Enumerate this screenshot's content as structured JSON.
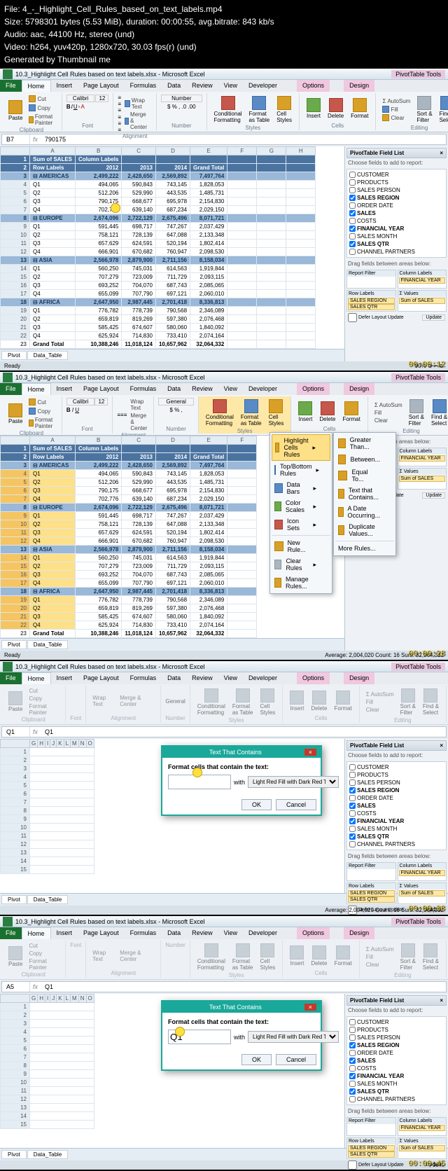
{
  "header": {
    "l1": "File: 4_-_Highlight_Cell_Rules_based_on_text_labels.mp4",
    "l2": "Size: 5798301 bytes (5.53 MiB), duration: 00:00:55, avg.bitrate: 843 kb/s",
    "l3": "Audio: aac, 44100 Hz, stereo (und)",
    "l4": "Video: h264, yuv420p, 1280x720, 30.03 fps(r) (und)",
    "l5": "Generated by Thumbnail me"
  },
  "title": "10.3_Highlight Cell Rules based on text labels.xlsx - Microsoft Excel",
  "ctxtab": "PivotTable Tools",
  "ctxsubs": {
    "opt": "Options",
    "des": "Design"
  },
  "tabs": {
    "file": "File",
    "home": "Home",
    "insert": "Insert",
    "layout": "Page Layout",
    "formulas": "Formulas",
    "data": "Data",
    "review": "Review",
    "view": "View",
    "dev": "Developer"
  },
  "rib": {
    "clipboard": "Clipboard",
    "font": "Font",
    "alignment": "Alignment",
    "number": "Number",
    "styles": "Styles",
    "cells": "Cells",
    "editing": "Editing",
    "paste": "Paste",
    "cut": "Cut",
    "copy": "Copy",
    "fpaint": "Format Painter",
    "fontname": "Calibri",
    "fontsize": "12",
    "wrap": "Wrap Text",
    "merge": "Merge & Center",
    "fmtNumber": "Number",
    "fmtGeneral": "General",
    "condf": "Conditional\nFormatting",
    "fat": "Format\nas Table",
    "cstyles": "Cell\nStyles",
    "insertc": "Insert",
    "deletec": "Delete",
    "formatc": "Format",
    "autosum": "AutoSum",
    "fill": "Fill",
    "clear": "Clear",
    "sortf": "Sort &\nFilter",
    "finds": "Find &\nSelect"
  },
  "nb1": {
    "cell": "B7",
    "val": "790175"
  },
  "nb3": {
    "cell": "Q1",
    "val": "Q1"
  },
  "nb4": {
    "cell": "A5",
    "val": "Q1"
  },
  "cols": [
    "A",
    "B",
    "C",
    "D",
    "E",
    "F",
    "G",
    "H",
    "I",
    "J",
    "K"
  ],
  "pivot": {
    "r1": {
      "a": "Sum of SALES",
      "b": "Column Labels"
    },
    "r2": {
      "a": "Row Labels",
      "b": "2012",
      "c": "2013",
      "d": "2014",
      "e": "Grand Total"
    },
    "reg1": {
      "a": "⊟ AMERICAS",
      "b": "2,499,222",
      "c": "2,428,650",
      "d": "2,569,892",
      "e": "7,497,764"
    },
    "q1a": {
      "a": "Q1",
      "b": "494,065",
      "c": "590,843",
      "d": "743,145",
      "e": "1,828,053"
    },
    "q2a": {
      "a": "Q2",
      "b": "512,206",
      "c": "529,990",
      "d": "443,535",
      "e": "1,485,731"
    },
    "q3a": {
      "a": "Q3",
      "b": "790,175",
      "c": "668,677",
      "d": "695,978",
      "e": "2,154,830"
    },
    "q4a": {
      "a": "Q4",
      "b": "702,776",
      "c": "639,140",
      "d": "687,234",
      "e": "2,029,150"
    },
    "reg2": {
      "a": "⊟ EUROPE",
      "b": "2,674,096",
      "c": "2,722,129",
      "d": "2,675,496",
      "e": "8,071,721"
    },
    "q1e": {
      "a": "Q1",
      "b": "591,445",
      "c": "698,717",
      "d": "747,267",
      "e": "2,037,429"
    },
    "q2e": {
      "a": "Q2",
      "b": "758,121",
      "c": "728,139",
      "d": "647,088",
      "e": "2,133,348"
    },
    "q3e": {
      "a": "Q3",
      "b": "657,629",
      "c": "624,591",
      "d": "520,194",
      "e": "1,802,414"
    },
    "q4e": {
      "a": "Q4",
      "b": "666,901",
      "c": "670,682",
      "d": "760,947",
      "e": "2,098,530"
    },
    "reg3": {
      "a": "⊟ ASIA",
      "b": "2,566,978",
      "c": "2,879,900",
      "d": "2,711,156",
      "e": "8,158,034"
    },
    "q1s": {
      "a": "Q1",
      "b": "560,250",
      "c": "745,031",
      "d": "614,563",
      "e": "1,919,844"
    },
    "q2s": {
      "a": "Q2",
      "b": "707,279",
      "c": "723,009",
      "d": "711,729",
      "e": "2,093,115"
    },
    "q3s": {
      "a": "Q3",
      "b": "693,252",
      "c": "704,070",
      "d": "687,743",
      "e": "2,085,065"
    },
    "q4s": {
      "a": "Q4",
      "b": "655,099",
      "c": "707,790",
      "d": "697,121",
      "e": "2,060,010"
    },
    "reg4": {
      "a": "⊟ AFRICA",
      "b": "2,647,950",
      "c": "2,987,445",
      "d": "2,701,418",
      "e": "8,336,813"
    },
    "q1f": {
      "a": "Q1",
      "b": "776,782",
      "c": "778,739",
      "d": "790,568",
      "e": "2,346,089"
    },
    "q2f": {
      "a": "Q2",
      "b": "659,819",
      "c": "819,269",
      "d": "597,380",
      "e": "2,076,468"
    },
    "q3f": {
      "a": "Q3",
      "b": "585,425",
      "c": "674,607",
      "d": "580,060",
      "e": "1,840,092"
    },
    "q4f": {
      "a": "Q4",
      "b": "625,924",
      "c": "714,830",
      "d": "733,410",
      "e": "2,074,164"
    },
    "gt": {
      "a": "Grand Total",
      "b": "10,388,246",
      "c": "11,018,124",
      "d": "10,657,962",
      "e": "32,064,332"
    }
  },
  "fl": {
    "title": "PivotTable Field List",
    "hint": "Choose fields to add to report:",
    "f": {
      "cust": "CUSTOMER",
      "prod": "PRODUCTS",
      "sp": "SALES PERSON",
      "sr": "SALES REGION",
      "od": "ORDER DATE",
      "sales": "SALES",
      "costs": "COSTS",
      "fy": "FINANCIAL YEAR",
      "sm": "SALES MONTH",
      "sq": "SALES QTR",
      "cp": "CHANNEL PARTNERS"
    },
    "drag": "Drag fields between areas below:",
    "areas": {
      "rf": "Report Filter",
      "cl": "Column Labels",
      "rl": "Row Labels",
      "val": "Σ  Values"
    },
    "items": {
      "fy": "FINANCIAL YEAR",
      "sr": "SALES REGION",
      "sq": "SALES QTR",
      "sum": "Sum of SALES"
    },
    "defer": "Defer Layout Update",
    "update": "Update"
  },
  "sheets": {
    "pivot": "Pivot",
    "dt": "Data_Table"
  },
  "status": {
    "ready": "Ready",
    "avg": "Average: 2,004,020   Count: 16   Sum: 32,064,332"
  },
  "ts": {
    "f1": "00:00:12",
    "f2": "00:00:28",
    "f3": "00:00:38",
    "f4": "00:00:45"
  },
  "cfmenu": {
    "hcr": "Highlight Cells Rules",
    "tbr": "Top/Bottom Rules",
    "db": "Data Bars",
    "cs": "Color Scales",
    "is": "Icon Sets",
    "nr": "New Rule...",
    "cr": "Clear Rules",
    "mr": "Manage Rules...",
    "gt": "Greater Than...",
    "bt": "Between...",
    "et": "Equal To...",
    "tc": "Text that Contains...",
    "do": "A Date Occurring...",
    "dv": "Duplicate Values...",
    "mr2": "More Rules..."
  },
  "dlg": {
    "title": "Text That Contains",
    "prompt": "Format cells that contain the text:",
    "with": "with",
    "fmt": "Light Red Fill with Dark Red Text",
    "ok": "OK",
    "cancel": "Cancel",
    "val4": "Q1"
  }
}
